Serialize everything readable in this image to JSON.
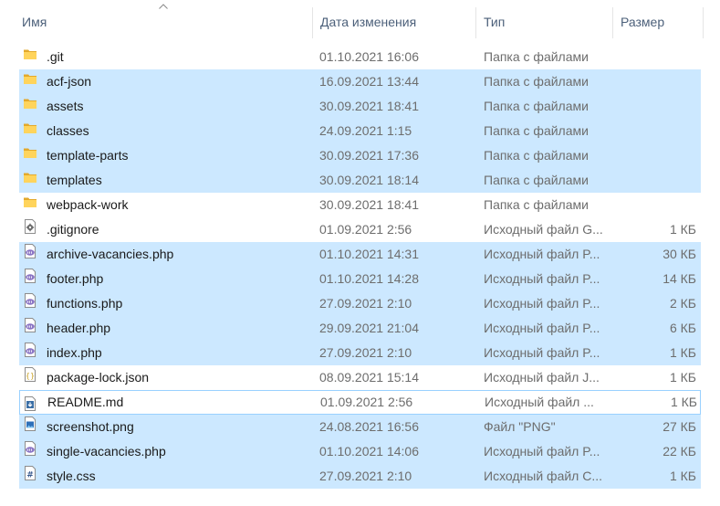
{
  "columns": {
    "name": "Имя",
    "date": "Дата изменения",
    "type": "Тип",
    "size": "Размер"
  },
  "files": [
    {
      "name": ".git",
      "date": "01.10.2021 16:06",
      "type": "Папка с файлами",
      "size": "",
      "icon": "folder-icon",
      "selected": false
    },
    {
      "name": "acf-json",
      "date": "16.09.2021 13:44",
      "type": "Папка с файлами",
      "size": "",
      "icon": "folder-icon",
      "selected": true
    },
    {
      "name": "assets",
      "date": "30.09.2021 18:41",
      "type": "Папка с файлами",
      "size": "",
      "icon": "folder-icon",
      "selected": true
    },
    {
      "name": "classes",
      "date": "24.09.2021 1:15",
      "type": "Папка с файлами",
      "size": "",
      "icon": "folder-icon",
      "selected": true
    },
    {
      "name": "template-parts",
      "date": "30.09.2021 17:36",
      "type": "Папка с файлами",
      "size": "",
      "icon": "folder-icon",
      "selected": true
    },
    {
      "name": "templates",
      "date": "30.09.2021 18:14",
      "type": "Папка с файлами",
      "size": "",
      "icon": "folder-icon",
      "selected": true
    },
    {
      "name": "webpack-work",
      "date": "30.09.2021 18:41",
      "type": "Папка с файлами",
      "size": "",
      "icon": "folder-icon",
      "selected": false
    },
    {
      "name": ".gitignore",
      "date": "01.09.2021 2:56",
      "type": "Исходный файл G...",
      "size": "1 КБ",
      "icon": "gear-file-icon",
      "selected": false
    },
    {
      "name": "archive-vacancies.php",
      "date": "01.10.2021 14:31",
      "type": "Исходный файл P...",
      "size": "30 КБ",
      "icon": "php-file-icon",
      "selected": true
    },
    {
      "name": "footer.php",
      "date": "01.10.2021 14:28",
      "type": "Исходный файл P...",
      "size": "14 КБ",
      "icon": "php-file-icon",
      "selected": true
    },
    {
      "name": "functions.php",
      "date": "27.09.2021 2:10",
      "type": "Исходный файл P...",
      "size": "2 КБ",
      "icon": "php-file-icon",
      "selected": true
    },
    {
      "name": "header.php",
      "date": "29.09.2021 21:04",
      "type": "Исходный файл P...",
      "size": "6 КБ",
      "icon": "php-file-icon",
      "selected": true
    },
    {
      "name": "index.php",
      "date": "27.09.2021 2:10",
      "type": "Исходный файл P...",
      "size": "1 КБ",
      "icon": "php-file-icon",
      "selected": true
    },
    {
      "name": "package-lock.json",
      "date": "08.09.2021 15:14",
      "type": "Исходный файл J...",
      "size": "1 КБ",
      "icon": "json-file-icon",
      "selected": false
    },
    {
      "name": "README.md",
      "date": "01.09.2021 2:56",
      "type": "Исходный файл ...",
      "size": "1 КБ",
      "icon": "markdown-file-icon",
      "selected": false,
      "focused": true
    },
    {
      "name": "screenshot.png",
      "date": "24.08.2021 16:56",
      "type": "Файл \"PNG\"",
      "size": "27 КБ",
      "icon": "image-file-icon",
      "selected": true
    },
    {
      "name": "single-vacancies.php",
      "date": "01.10.2021 14:06",
      "type": "Исходный файл P...",
      "size": "22 КБ",
      "icon": "php-file-icon",
      "selected": true
    },
    {
      "name": "style.css",
      "date": "27.09.2021 2:10",
      "type": "Исходный файл C...",
      "size": "1 КБ",
      "icon": "css-file-icon",
      "selected": true
    }
  ]
}
